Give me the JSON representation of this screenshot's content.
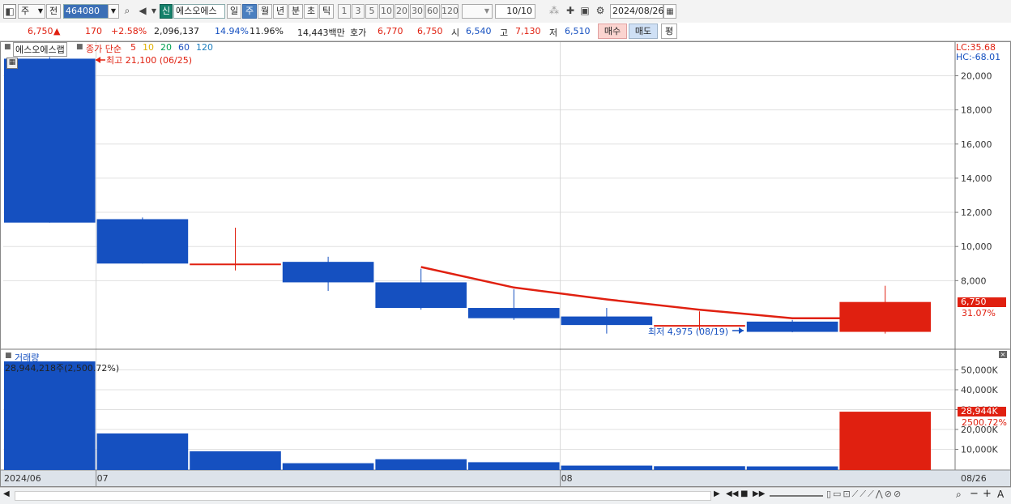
{
  "toolbar": {
    "menu_label": "주",
    "prev_label": "전",
    "code": "464080",
    "badge": "신",
    "name": "에스오에스",
    "periods": [
      "일",
      "주",
      "월",
      "년",
      "분",
      "초",
      "틱"
    ],
    "selected_period": "주",
    "intervals": [
      "1",
      "3",
      "5",
      "10",
      "20",
      "30",
      "60",
      "120"
    ],
    "count": "10/10",
    "date": "2024/08/26"
  },
  "quote": {
    "price": "6,750",
    "arrow": "▲",
    "change": "170",
    "change_pct": "+2.58%",
    "volume": "2,096,137",
    "pct1": "14.94%",
    "pct2": "11.96%",
    "amount": "14,443백만",
    "hoga_label": "호가",
    "ask": "6,770",
    "bid": "6,750",
    "open_label": "시",
    "open": "6,540",
    "high_label": "고",
    "high": "7,130",
    "low_label": "저",
    "low": "6,510",
    "buy_label": "매수",
    "sell_label": "매도",
    "avg_label": "평"
  },
  "legend": {
    "name": "에스오에스랩",
    "ma_label": "종가 단순",
    "ma_periods": [
      "5",
      "10",
      "20",
      "60",
      "120"
    ],
    "ma_colors": [
      "#e02010",
      "#e0b000",
      "#00a050",
      "#1a4fbf",
      "#2080c0"
    ],
    "lc": "LC:35.68",
    "hc": "HC:-68.01",
    "max_label": "최고 21,100 (06/25)",
    "min_label": "최저 4,975 (08/19)",
    "cur_price": "6,750",
    "cur_pct": "31.07%",
    "vol_title": "거래량",
    "vol_info": "28,944,218주(2,500.72%)",
    "vol_cur": "28,944K",
    "vol_pct": "2500.72%"
  },
  "chart_data": [
    {
      "type": "candlestick",
      "interval": "weekly",
      "y_ticks": [
        20000,
        18000,
        16000,
        14000,
        12000,
        10000,
        8000
      ],
      "y_tick_labels": [
        "20,000",
        "18,000",
        "16,000",
        "14,000",
        "12,000",
        "10,000",
        "8,000"
      ],
      "x_labels": [
        {
          "label": "2024/06",
          "index": 0
        },
        {
          "label": "07",
          "index": 1
        },
        {
          "label": "08",
          "index": 6
        },
        {
          "label": "08/26",
          "index": 10
        }
      ],
      "candles": [
        {
          "open": 21000,
          "high": 21100,
          "low": 11400,
          "close": 11400
        },
        {
          "open": 11600,
          "high": 11700,
          "low": 9000,
          "close": 9000
        },
        {
          "open": 9000,
          "high": 11100,
          "low": 8600,
          "close": 9000
        },
        {
          "open": 9100,
          "high": 9400,
          "low": 7400,
          "close": 7900
        },
        {
          "open": 7900,
          "high": 8700,
          "low": 6300,
          "close": 6400
        },
        {
          "open": 6400,
          "high": 7500,
          "low": 5700,
          "close": 5800
        },
        {
          "open": 5900,
          "high": 6400,
          "low": 4900,
          "close": 5400
        },
        {
          "open": 5400,
          "high": 6200,
          "low": 5100,
          "close": 5400
        },
        {
          "open": 5600,
          "high": 5700,
          "low": 4975,
          "close": 5000
        },
        {
          "open": 5000,
          "high": 7700,
          "low": 4900,
          "close": 6750
        }
      ],
      "ma5": [
        null,
        null,
        null,
        null,
        8800,
        7600,
        6900,
        6300,
        5800,
        5800
      ]
    },
    {
      "type": "bar",
      "title": "거래량",
      "y_ticks": [
        50000,
        40000,
        30000,
        20000,
        10000
      ],
      "y_tick_labels": [
        "50,000K",
        "40,000K",
        "30,000K",
        "20,000K",
        "10,000K"
      ],
      "values_k": [
        55000,
        18000,
        9000,
        3000,
        5000,
        3500,
        1800,
        1500,
        1400,
        28944
      ]
    }
  ],
  "colors": {
    "up": "#e02010",
    "down": "#1550c0",
    "ma5": "#e02010",
    "grid": "#e0e0e0"
  }
}
